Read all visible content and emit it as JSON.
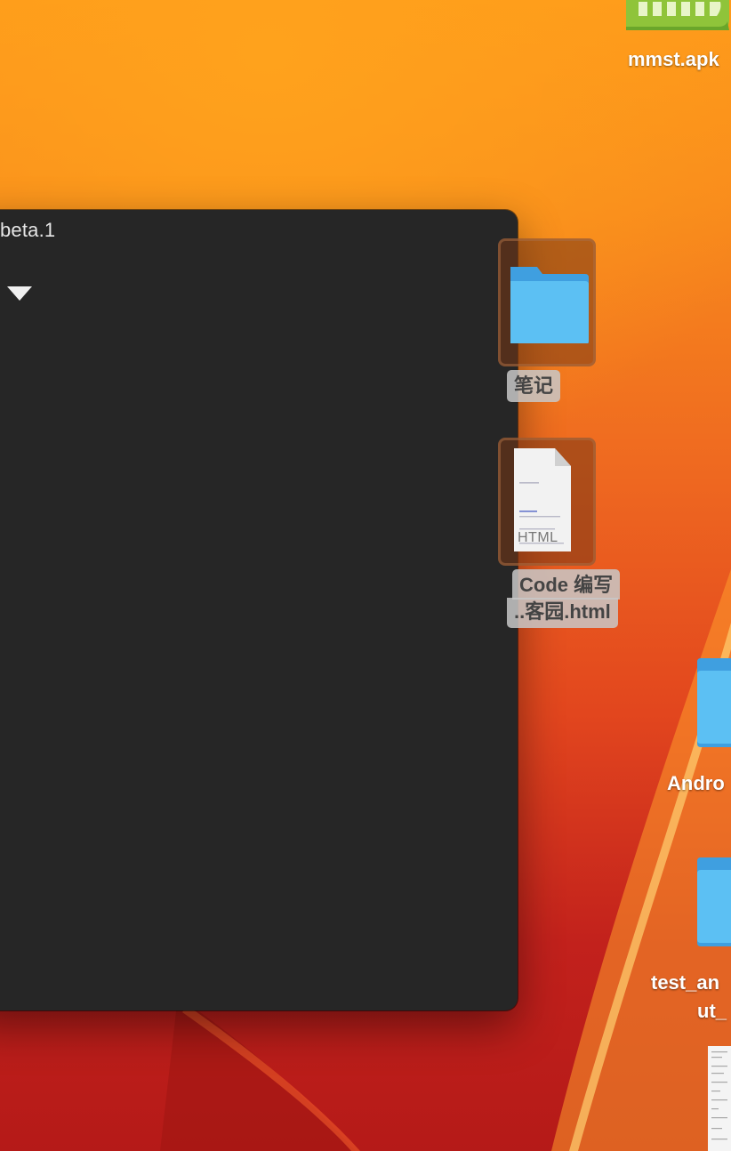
{
  "window": {
    "title_fragment": "beta.1"
  },
  "desktop": {
    "items": [
      {
        "label": "mmst.apk",
        "icon": "apk-icon"
      },
      {
        "label": "笔记",
        "icon": "folder-icon"
      },
      {
        "label_line1": "Code 编写",
        "label_line2": "..客园.html",
        "icon": "html-file-icon",
        "badge": "HTML"
      },
      {
        "label": "Andro",
        "icon": "folder-icon"
      },
      {
        "label_line1": "test_an",
        "label_line2": "ut_",
        "icon": "folder-icon"
      },
      {
        "icon": "document-icon"
      }
    ]
  },
  "colors": {
    "window_bg": "#262626",
    "folder_blue": "#5cc0f3",
    "apk_green": "#8fc43a"
  }
}
